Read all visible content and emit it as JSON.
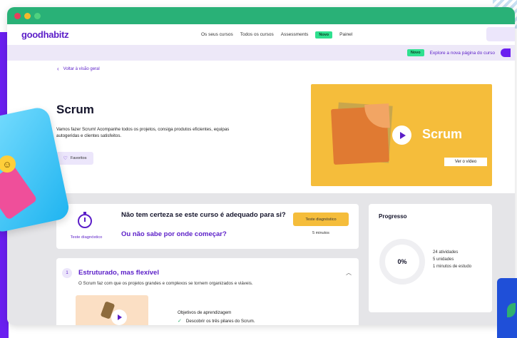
{
  "nav": {
    "logo": "goodhabitz",
    "links": [
      "Os seus cursos",
      "Todos os cursos",
      "Assessments"
    ],
    "badge": "Novo",
    "last_link": "Painel"
  },
  "banner": {
    "badge": "Novo",
    "text": "Explore a nova página do curso"
  },
  "course": {
    "back_link": "Voltar à visão geral",
    "title": "Scrum",
    "description": "Vamos fazer Scrum! Acompanhe todos os projetos, consiga produtos eficientes, equipas autogeridas e clientes satisfeitos.",
    "favorite_label": "Favoritos"
  },
  "video": {
    "title": "Scrum",
    "watch_label": "Ver o vídeo"
  },
  "diagnostic": {
    "label": "Teste diagnóstico",
    "question1": "Não tem certeza se este curso é adequado para si?",
    "question2": "Ou não sabe por onde começar?",
    "button": "Teste diagnóstico",
    "duration": "5 minutos"
  },
  "module": {
    "number": "1",
    "title": "Estruturado, mas flexível",
    "description": "O Scrum faz com que os projetos grandes e complexos se tornem organizados e viáveis.",
    "objectives_title": "Objetivos de aprendizagem",
    "objective_1": "Descobrir os três pilares do Scrum."
  },
  "progress": {
    "title": "Progresso",
    "percent": "0%",
    "activities": "24 atividades",
    "units": "5 unidades",
    "study_time": "1 minutos de estudo"
  },
  "colors": {
    "brand_purple": "#5b1ec8",
    "accent_yellow": "#f5bd3b",
    "badge_green": "#2fe08f",
    "titlebar_green": "#29b177"
  }
}
